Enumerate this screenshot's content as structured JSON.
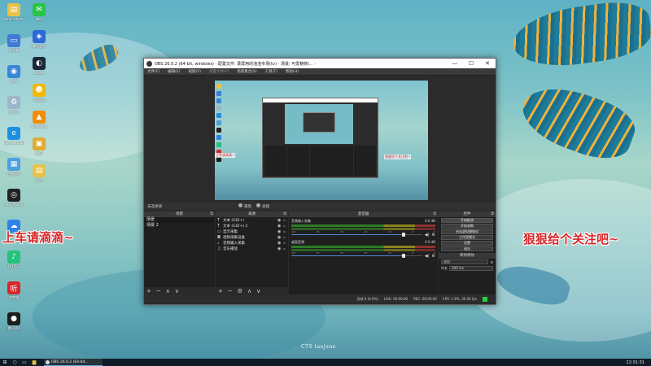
{
  "desktop": {
    "icons_left": [
      {
        "label": "Administrator",
        "icon": "user-folder-icon",
        "color": "#e7c24a"
      },
      {
        "label": "此电脑",
        "icon": "computer-icon",
        "color": "#3f7bd6"
      },
      {
        "label": "网络",
        "icon": "network-icon",
        "color": "#3a86d8"
      },
      {
        "label": "回收站",
        "icon": "recycle-bin-icon",
        "color": "#9bb6c9"
      },
      {
        "label": "Internet Explorer",
        "icon": "ie-icon",
        "color": "#1c8fe0"
      },
      {
        "label": "控制面板",
        "icon": "control-panel-icon",
        "color": "#4aa0e0"
      },
      {
        "label": "OBS Studio",
        "icon": "obs-icon",
        "color": "#222222"
      },
      {
        "label": "百度网盘",
        "icon": "cloud-icon",
        "color": "#2f83e6"
      },
      {
        "label": "QQ音乐",
        "icon": "qqmusic-icon",
        "color": "#24c27a"
      },
      {
        "label": "快剪辑",
        "icon": "ting-icon",
        "color": "#d8262a"
      },
      {
        "label": "腾讯QQ",
        "icon": "qq-icon",
        "color": "#1d1d1d"
      }
    ],
    "icons_right": [
      {
        "label": "微信",
        "icon": "wechat-icon",
        "color": "#28c445"
      },
      {
        "label": "腾讯会议",
        "icon": "meeting-icon",
        "color": "#2c69d6"
      },
      {
        "label": "Steam",
        "icon": "steam-icon",
        "color": "#1b2838"
      },
      {
        "label": "QQ游戏",
        "icon": "qqgame-icon",
        "color": "#f5b700"
      },
      {
        "label": "VideoLAN",
        "icon": "vlc-icon",
        "color": "#f28c00"
      },
      {
        "label": "快压",
        "icon": "zip-icon",
        "color": "#e1aa32"
      },
      {
        "label": "文件",
        "icon": "file-icon",
        "color": "#e7c24a"
      }
    ],
    "overlay_left": "上车请滴滴~",
    "overlay_right": "狠狠给个关注吧~",
    "watermark": "CTS taejune"
  },
  "taskbar": {
    "start_icon": "windows-start-icon",
    "app_label": "OBS 26.0.2 (64-bit...",
    "clock": "22:01:31"
  },
  "obs": {
    "title": "OBS 26.0.2 (64-bit, windows) - 配置文件: 录屏用的泡泡专场(tv) - 场景: 可爱精修(... -",
    "window_controls": {
      "minimize": "—",
      "maximize": "☐",
      "close": "✕"
    },
    "menu": [
      "文件(F)",
      "编辑(E)",
      "视图(V)",
      "配置文件(P)",
      "场景集合(S)",
      "工具(T)",
      "帮助(H)"
    ],
    "scenebar": {
      "left": "未选择源",
      "properties": "属性",
      "filters": "滤镜"
    },
    "docks": {
      "scenes": {
        "title": "场景",
        "items": [
          "场景",
          "场景 2"
        ],
        "footer": [
          "+",
          "−",
          "∧",
          "∨"
        ]
      },
      "sources": {
        "title": "来源",
        "items": [
          {
            "name": "文本 (GDI+)",
            "icon": "text-icon"
          },
          {
            "name": "文本 (GDI+) 2",
            "icon": "text-icon"
          },
          {
            "name": "显示采集",
            "icon": "monitor-icon"
          },
          {
            "name": "视频采集设备",
            "icon": "camera-icon"
          },
          {
            "name": "音频输入采集",
            "icon": "microphone-icon"
          },
          {
            "name": "音乐播放",
            "icon": "speaker-icon"
          }
        ],
        "footer": [
          "+",
          "−",
          "⚙",
          "∧",
          "∨"
        ]
      },
      "mixer": {
        "title": "混音器",
        "tracks": [
          {
            "name": "音频输入采集",
            "db": "0.0 dB",
            "level": 0.86
          },
          {
            "name": "桌面音频",
            "db": "0.0 dB",
            "level": 0.86
          }
        ]
      },
      "controls": {
        "title": "控件",
        "buttons": [
          "开始推流",
          "开始录制",
          "启动虚拟摄像机",
          "工作室模式",
          "设置",
          "退出"
        ],
        "transitions_title": "转场特效",
        "transition": "淡出",
        "duration_label": "时长",
        "duration": "300 ms"
      }
    },
    "status": {
      "dropped": "丢帧 0 (0.0%)",
      "live": "LIVE: 00:00:00",
      "rec": "REC: 00:00:00",
      "cpu": "CPU: 1.8%, 30.00 fps",
      "ok_color": "#1fd23a"
    },
    "preview": {
      "label_left": "上车请滴滴~",
      "label_right": "狠狠给个关注吧~"
    }
  }
}
